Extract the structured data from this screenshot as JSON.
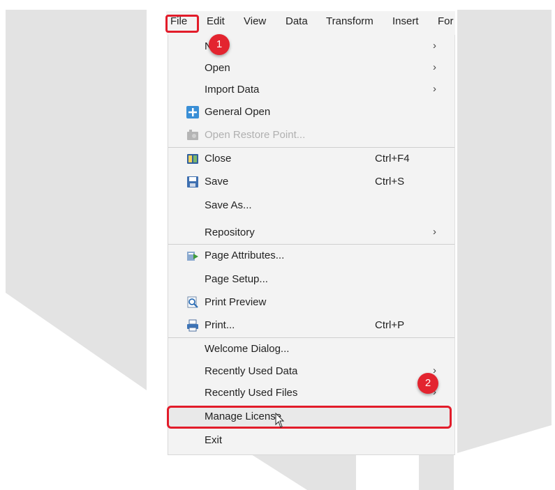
{
  "menubar": [
    "File",
    "Edit",
    "View",
    "Data",
    "Transform",
    "Insert",
    "For"
  ],
  "menu": {
    "new": "New",
    "open": "Open",
    "import_data": "Import Data",
    "general_open": "General Open",
    "open_restore_point": "Open Restore Point...",
    "close": "Close",
    "close_shortcut": "Ctrl+F4",
    "save": "Save",
    "save_shortcut": "Ctrl+S",
    "save_as": "Save As...",
    "repository": "Repository",
    "page_attributes": "Page Attributes...",
    "page_setup": "Page Setup...",
    "print_preview": "Print Preview",
    "print": "Print...",
    "print_shortcut": "Ctrl+P",
    "welcome_dialog": "Welcome Dialog...",
    "recently_used_data": "Recently Used Data",
    "recently_used_files": "Recently Used Files",
    "manage_license": "Manage License",
    "exit": "Exit",
    "submenu_arrow": "›"
  },
  "steps": [
    "1",
    "2"
  ],
  "colors": {
    "highlight": "#e21c2a",
    "badge": "#e3242f",
    "watermark": "#e3e3e3"
  }
}
